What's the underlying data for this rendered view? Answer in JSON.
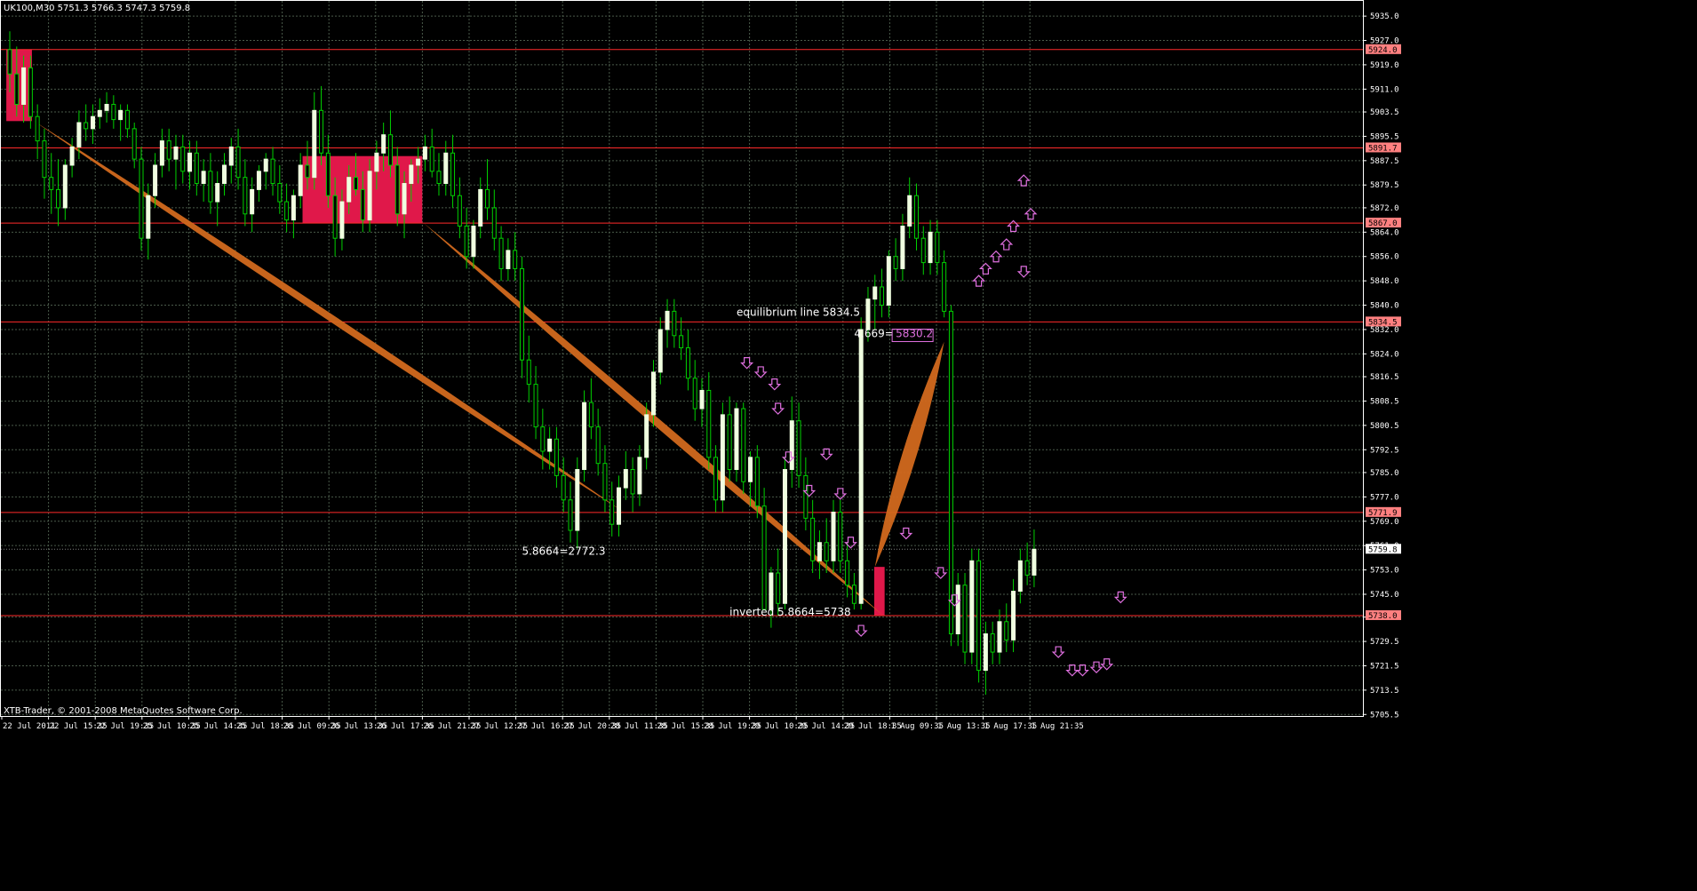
{
  "header": {
    "symbol_line": "UK100,M30  5751.3 5766.3 5747.3 5759.8"
  },
  "footer": {
    "copyright": "XTB-Trader, © 2001-2008 MetaQuotes Software Corp."
  },
  "colors": {
    "background": "#000000",
    "grid": "#4a5a4a",
    "frame": "#ffffff",
    "bull_candle": "#f0ffe0",
    "bear_candle": "#000000",
    "wick": "#00d000",
    "level_line": "#ff2a2a",
    "zone": "#e0184a",
    "band": "#d2691e",
    "arrow": "#e070e0",
    "label_text": "#ffffff",
    "price_tag": "#ff8080"
  },
  "chart_data": {
    "type": "candlestick",
    "ylim": [
      5705.0,
      5940.0
    ],
    "y_ticks": [
      "5935.0",
      "5927.0",
      "5919.0",
      "5911.0",
      "5903.5",
      "5895.5",
      "5887.5",
      "5879.5",
      "5872.0",
      "5864.0",
      "5856.0",
      "5848.0",
      "5840.0",
      "5832.0",
      "5824.0",
      "5816.5",
      "5808.5",
      "5800.5",
      "5792.5",
      "5785.0",
      "5777.0",
      "5769.0",
      "5761.0",
      "5753.0",
      "5745.0",
      "5737.5",
      "5729.5",
      "5721.5",
      "5713.5",
      "5705.5"
    ],
    "x_ticks": [
      "22 Jul 2011",
      "22 Jul 15:35",
      "22 Jul 19:35",
      "25 Jul 10:35",
      "25 Jul 14:35",
      "25 Jul 18:35",
      "26 Jul 09:35",
      "26 Jul 13:35",
      "26 Jul 17:35",
      "26 Jul 21:35",
      "27 Jul 12:35",
      "27 Jul 16:35",
      "27 Jul 20:35",
      "28 Jul 11:35",
      "28 Jul 15:35",
      "28 Jul 19:35",
      "29 Jul 10:35",
      "29 Jul 14:35",
      "29 Jul 18:35",
      "1 Aug 09:35",
      "1 Aug 13:35",
      "1 Aug 17:35",
      "1 Aug 21:35"
    ],
    "levels": [
      {
        "price": 5924.0,
        "label": "5924.0"
      },
      {
        "price": 5891.7,
        "label": "5891.7"
      },
      {
        "price": 5867.0,
        "label": "5867.0"
      },
      {
        "price": 5834.5,
        "label": "5834.5"
      },
      {
        "price": 5771.9,
        "label": "5771.9"
      },
      {
        "price": 5738.0,
        "label": "5738.0"
      }
    ],
    "current_price": {
      "price": 5759.8,
      "label": "5759.8"
    },
    "annotations": [
      {
        "text": "equilibrium line 5834.5",
        "bar": 105,
        "price": 5836.5
      },
      {
        "text": "4.669=",
        "bar": 122,
        "price": 5829.5
      },
      {
        "text": "5830.2",
        "bar": 128,
        "price": 5829.5,
        "boxed": true
      },
      {
        "text": "5.8664=2772.3",
        "bar": 74,
        "price": 5758.0
      },
      {
        "text": "inverted 5.8664=5738",
        "bar": 104,
        "price": 5738.0
      }
    ],
    "zones": [
      {
        "bar_start": -0.5,
        "bar_end": 3.2,
        "top": 5924.0,
        "bottom": 5900.5
      },
      {
        "bar_start": 42.3,
        "bar_end": 59.6,
        "top": 5889.0,
        "bottom": 5867.0
      },
      {
        "bar_start": 124.9,
        "bar_end": 126.4,
        "top": 5754.0,
        "bottom": 5738.0
      }
    ],
    "bands": [
      {
        "from": [
          3.5,
          5900.5
        ],
        "to": [
          88.8,
          5771.9
        ],
        "width": 0.8
      },
      {
        "from": [
          59.8,
          5867.0
        ],
        "to": [
          126.2,
          5738.0
        ],
        "width": 0.9
      },
      {
        "from": [
          125.0,
          5754.0
        ],
        "to": [
          135.0,
          5828.0
        ],
        "width": 1.6
      }
    ],
    "arrows_down": [
      [
        106.5,
        5821
      ],
      [
        108.5,
        5818
      ],
      [
        110.5,
        5814
      ],
      [
        111,
        5806
      ],
      [
        112.5,
        5790
      ],
      [
        115.5,
        5779
      ],
      [
        118,
        5791
      ],
      [
        120,
        5778
      ],
      [
        121.5,
        5762
      ],
      [
        123,
        5733
      ],
      [
        129.5,
        5765
      ],
      [
        134.5,
        5752
      ],
      [
        136.5,
        5743
      ],
      [
        146.5,
        5851
      ],
      [
        151.5,
        5726
      ],
      [
        153.5,
        5720
      ],
      [
        155,
        5720
      ],
      [
        157,
        5721
      ],
      [
        158.5,
        5722
      ],
      [
        160.5,
        5744
      ]
    ],
    "arrows_up": [
      [
        140,
        5848
      ],
      [
        141,
        5852
      ],
      [
        142.5,
        5856
      ],
      [
        144,
        5860
      ],
      [
        145,
        5866
      ],
      [
        146.5,
        5881
      ],
      [
        147.5,
        5870
      ]
    ],
    "candles": [
      [
        5924.0,
        5930.0,
        5910.0,
        5916.0
      ],
      [
        5916.0,
        5925.0,
        5902.0,
        5906.0
      ],
      [
        5906.0,
        5922.0,
        5900.0,
        5918.0
      ],
      [
        5918.0,
        5922.0,
        5898.0,
        5902.0
      ],
      [
        5902.0,
        5906.0,
        5888.0,
        5894.0
      ],
      [
        5894.0,
        5898.0,
        5875.0,
        5882.0
      ],
      [
        5882.0,
        5890.0,
        5870.0,
        5878.0
      ],
      [
        5878.0,
        5888.0,
        5866.0,
        5872.0
      ],
      [
        5872.0,
        5888.0,
        5868.0,
        5886.0
      ],
      [
        5886.0,
        5895.0,
        5882.0,
        5892.0
      ],
      [
        5892.0,
        5904.0,
        5888.0,
        5900.0
      ],
      [
        5900.0,
        5906.0,
        5894.0,
        5898.0
      ],
      [
        5898.0,
        5906.0,
        5893.0,
        5902.0
      ],
      [
        5902.0,
        5908.0,
        5898.0,
        5904.0
      ],
      [
        5904.0,
        5910.0,
        5900.0,
        5906.0
      ],
      [
        5906.0,
        5909.0,
        5898.0,
        5901.0
      ],
      [
        5901.0,
        5906.0,
        5894.0,
        5904.0
      ],
      [
        5904.0,
        5906.0,
        5895.0,
        5898.0
      ],
      [
        5898.0,
        5900.0,
        5885.0,
        5888.0
      ],
      [
        5888.0,
        5892.0,
        5858.0,
        5862.0
      ],
      [
        5862.0,
        5880.0,
        5855.0,
        5876.0
      ],
      [
        5876.0,
        5890.0,
        5872.0,
        5886.0
      ],
      [
        5886.0,
        5898.0,
        5882.0,
        5894.0
      ],
      [
        5894.0,
        5898.0,
        5884.0,
        5888.0
      ],
      [
        5888.0,
        5896.0,
        5878.0,
        5892.0
      ],
      [
        5892.0,
        5896.0,
        5880.0,
        5884.0
      ],
      [
        5884.0,
        5894.0,
        5878.0,
        5890.0
      ],
      [
        5890.0,
        5894.0,
        5876.0,
        5880.0
      ],
      [
        5880.0,
        5888.0,
        5874.0,
        5884.0
      ],
      [
        5884.0,
        5890.0,
        5870.0,
        5874.0
      ],
      [
        5874.0,
        5884.0,
        5866.0,
        5880.0
      ],
      [
        5880.0,
        5890.0,
        5876.0,
        5886.0
      ],
      [
        5886.0,
        5895.0,
        5880.0,
        5892.0
      ],
      [
        5892.0,
        5898.0,
        5878.0,
        5882.0
      ],
      [
        5882.0,
        5888.0,
        5866.0,
        5870.0
      ],
      [
        5870.0,
        5882.0,
        5864.0,
        5878.0
      ],
      [
        5878.0,
        5886.0,
        5874.0,
        5884.0
      ],
      [
        5884.0,
        5890.0,
        5878.0,
        5888.0
      ],
      [
        5888.0,
        5892.0,
        5876.0,
        5880.0
      ],
      [
        5880.0,
        5886.0,
        5870.0,
        5874.0
      ],
      [
        5874.0,
        5880.0,
        5864.0,
        5868.0
      ],
      [
        5868.0,
        5878.0,
        5862.0,
        5876.0
      ],
      [
        5876.0,
        5890.0,
        5872.0,
        5886.0
      ],
      [
        5886.0,
        5894.0,
        5878.0,
        5882.0
      ],
      [
        5882.0,
        5910.0,
        5878.0,
        5904.0
      ],
      [
        5904.0,
        5912.0,
        5886.0,
        5890.0
      ],
      [
        5890.0,
        5896.0,
        5872.0,
        5876.0
      ],
      [
        5876.0,
        5882.0,
        5856.0,
        5862.0
      ],
      [
        5862.0,
        5878.0,
        5858.0,
        5874.0
      ],
      [
        5874.0,
        5886.0,
        5870.0,
        5882.0
      ],
      [
        5882.0,
        5890.0,
        5876.0,
        5878.0
      ],
      [
        5878.0,
        5884.0,
        5864.0,
        5868.0
      ],
      [
        5868.0,
        5888.0,
        5864.0,
        5884.0
      ],
      [
        5884.0,
        5894.0,
        5878.0,
        5890.0
      ],
      [
        5890.0,
        5900.0,
        5884.0,
        5896.0
      ],
      [
        5896.0,
        5904.0,
        5882.0,
        5886.0
      ],
      [
        5886.0,
        5892.0,
        5866.0,
        5870.0
      ],
      [
        5870.0,
        5884.0,
        5862.0,
        5880.0
      ],
      [
        5880.0,
        5888.0,
        5874.0,
        5886.0
      ],
      [
        5886.0,
        5892.0,
        5880.0,
        5888.0
      ],
      [
        5888.0,
        5896.0,
        5884.0,
        5892.0
      ],
      [
        5892.0,
        5898.0,
        5882.0,
        5884.0
      ],
      [
        5884.0,
        5890.0,
        5876.0,
        5880.0
      ],
      [
        5880.0,
        5894.0,
        5876.0,
        5890.0
      ],
      [
        5890.0,
        5896.0,
        5872.0,
        5876.0
      ],
      [
        5876.0,
        5882.0,
        5862.0,
        5866.0
      ],
      [
        5866.0,
        5872.0,
        5852.0,
        5856.0
      ],
      [
        5856.0,
        5868.0,
        5852.0,
        5866.0
      ],
      [
        5866.0,
        5882.0,
        5862.0,
        5878.0
      ],
      [
        5878.0,
        5888.0,
        5868.0,
        5872.0
      ],
      [
        5872.0,
        5878.0,
        5858.0,
        5862.0
      ],
      [
        5862.0,
        5866.0,
        5848.0,
        5852.0
      ],
      [
        5852.0,
        5862.0,
        5848.0,
        5858.0
      ],
      [
        5858.0,
        5864.0,
        5848.0,
        5852.0
      ],
      [
        5852.0,
        5856.0,
        5816.0,
        5822.0
      ],
      [
        5822.0,
        5830.0,
        5808.0,
        5814.0
      ],
      [
        5814.0,
        5820.0,
        5796.0,
        5800.0
      ],
      [
        5800.0,
        5806.0,
        5786.0,
        5792.0
      ],
      [
        5792.0,
        5800.0,
        5786.0,
        5796.0
      ],
      [
        5796.0,
        5800.0,
        5780.0,
        5784.0
      ],
      [
        5784.0,
        5790.0,
        5772.0,
        5776.0
      ],
      [
        5776.0,
        5782.0,
        5762.0,
        5766.0
      ],
      [
        5766.0,
        5790.0,
        5760.0,
        5786.0
      ],
      [
        5786.0,
        5812.0,
        5782.0,
        5808.0
      ],
      [
        5808.0,
        5816.0,
        5796.0,
        5800.0
      ],
      [
        5800.0,
        5806.0,
        5784.0,
        5788.0
      ],
      [
        5788.0,
        5794.0,
        5772.0,
        5776.0
      ],
      [
        5776.0,
        5782.0,
        5764.0,
        5768.0
      ],
      [
        5768.0,
        5784.0,
        5764.0,
        5780.0
      ],
      [
        5780.0,
        5792.0,
        5776.0,
        5786.0
      ],
      [
        5786.0,
        5790.0,
        5772.0,
        5778.0
      ],
      [
        5778.0,
        5794.0,
        5774.0,
        5790.0
      ],
      [
        5790.0,
        5808.0,
        5786.0,
        5804.0
      ],
      [
        5804.0,
        5822.0,
        5800.0,
        5818.0
      ],
      [
        5818.0,
        5836.0,
        5814.0,
        5832.0
      ],
      [
        5832.0,
        5842.0,
        5826.0,
        5838.0
      ],
      [
        5838.0,
        5842.0,
        5826.0,
        5830.0
      ],
      [
        5830.0,
        5836.0,
        5822.0,
        5826.0
      ],
      [
        5826.0,
        5832.0,
        5812.0,
        5816.0
      ],
      [
        5816.0,
        5822.0,
        5802.0,
        5806.0
      ],
      [
        5806.0,
        5816.0,
        5800.0,
        5812.0
      ],
      [
        5812.0,
        5818.0,
        5786.0,
        5790.0
      ],
      [
        5790.0,
        5794.0,
        5772.0,
        5776.0
      ],
      [
        5776.0,
        5808.0,
        5772.0,
        5804.0
      ],
      [
        5804.0,
        5810.0,
        5782.0,
        5786.0
      ],
      [
        5786.0,
        5808.0,
        5782.0,
        5806.0
      ],
      [
        5806.0,
        5808.0,
        5778.0,
        5782.0
      ],
      [
        5782.0,
        5792.0,
        5774.0,
        5790.0
      ],
      [
        5790.0,
        5794.0,
        5770.0,
        5774.0
      ],
      [
        5774.0,
        5780.0,
        5742.0,
        5740.0
      ],
      [
        5740.0,
        5754.0,
        5734.0,
        5752.0
      ],
      [
        5752.0,
        5760.0,
        5738.0,
        5742.0
      ],
      [
        5742.0,
        5790.0,
        5740.0,
        5786.0
      ],
      [
        5786.0,
        5810.0,
        5780.0,
        5802.0
      ],
      [
        5802.0,
        5808.0,
        5780.0,
        5784.0
      ],
      [
        5784.0,
        5790.0,
        5766.0,
        5770.0
      ],
      [
        5770.0,
        5776.0,
        5752.0,
        5756.0
      ],
      [
        5756.0,
        5766.0,
        5750.0,
        5762.0
      ],
      [
        5762.0,
        5770.0,
        5752.0,
        5756.0
      ],
      [
        5756.0,
        5776.0,
        5752.0,
        5772.0
      ],
      [
        5772.0,
        5776.0,
        5752.0,
        5756.0
      ],
      [
        5756.0,
        5762.0,
        5744.0,
        5748.0
      ],
      [
        5748.0,
        5752.0,
        5740.0,
        5742.0
      ],
      [
        5742.0,
        5836.0,
        5740.0,
        5832.0
      ],
      [
        5832.0,
        5846.0,
        5828.0,
        5842.0
      ],
      [
        5842.0,
        5850.0,
        5832.0,
        5846.0
      ],
      [
        5846.0,
        5852.0,
        5836.0,
        5840.0
      ],
      [
        5840.0,
        5858.0,
        5836.0,
        5856.0
      ],
      [
        5856.0,
        5862.0,
        5848.0,
        5852.0
      ],
      [
        5852.0,
        5870.0,
        5848.0,
        5866.0
      ],
      [
        5866.0,
        5882.0,
        5862.0,
        5876.0
      ],
      [
        5876.0,
        5880.0,
        5858.0,
        5862.0
      ],
      [
        5862.0,
        5866.0,
        5850.0,
        5854.0
      ],
      [
        5854.0,
        5868.0,
        5850.0,
        5864.0
      ],
      [
        5864.0,
        5868.0,
        5850.0,
        5854.0
      ],
      [
        5854.0,
        5858.0,
        5836.0,
        5838.0
      ],
      [
        5838.0,
        5840.0,
        5728.0,
        5732.0
      ],
      [
        5732.0,
        5752.0,
        5728.0,
        5748.0
      ],
      [
        5748.0,
        5752.0,
        5722.0,
        5726.0
      ],
      [
        5726.0,
        5760.0,
        5722.0,
        5756.0
      ],
      [
        5756.0,
        5760.0,
        5716.0,
        5720.0
      ],
      [
        5720.0,
        5736.0,
        5712.0,
        5732.0
      ],
      [
        5732.0,
        5736.0,
        5722.0,
        5726.0
      ],
      [
        5726.0,
        5740.0,
        5722.0,
        5736.0
      ],
      [
        5736.0,
        5742.0,
        5726.0,
        5730.0
      ],
      [
        5730.0,
        5750.0,
        5726.0,
        5746.0
      ],
      [
        5746.0,
        5760.0,
        5742.0,
        5756.0
      ],
      [
        5756.0,
        5762.0,
        5748.0,
        5751.3
      ],
      [
        5751.3,
        5766.3,
        5747.3,
        5759.8
      ]
    ]
  }
}
